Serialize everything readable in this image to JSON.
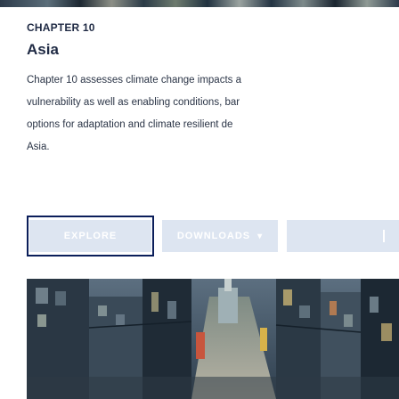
{
  "chapter": {
    "kicker": "CHAPTER 10",
    "title": "Asia",
    "description_lines": [
      "Chapter 10 assesses climate change impacts a",
      "vulnerability as well as enabling conditions, bar",
      "options for adaptation and climate resilient de",
      "Asia."
    ]
  },
  "actions": {
    "explore_label": "EXPLORE",
    "downloads_label": "DOWNLOADS",
    "downloads_icon": "chevron-down-icon"
  },
  "colors": {
    "text": "#1f2a44",
    "button_bg": "#dde5f1",
    "focus_ring": "#0b1e5a"
  }
}
